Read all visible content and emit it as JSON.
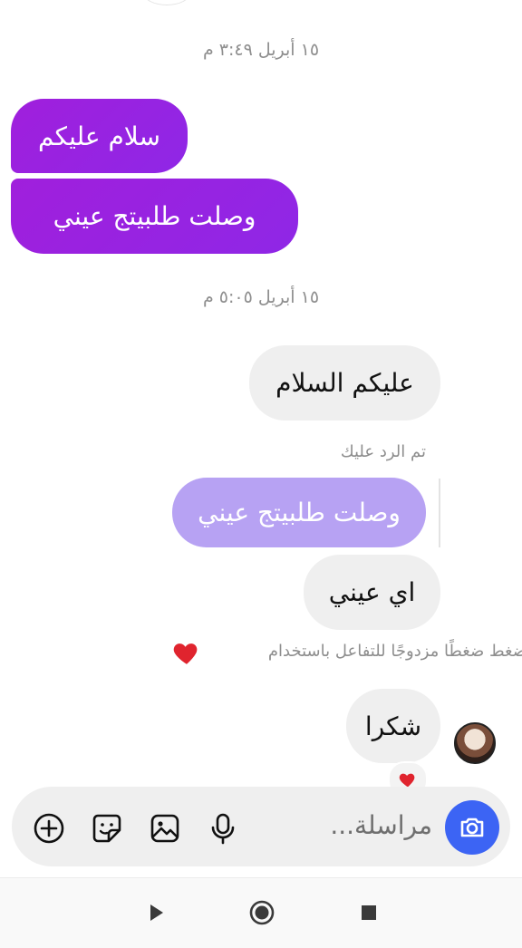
{
  "thread": {
    "timestamp_1": "١٥ أبريل ٣:٤٩ م",
    "timestamp_2": "١٥ أبريل ٥:٠٥ م",
    "messages": [
      {
        "text": "سلام عليكم"
      },
      {
        "text": "وصلت طلبيتج عيني"
      },
      {
        "text": "عليكم السلام"
      },
      {
        "text": "اي عيني"
      },
      {
        "text": "شكرا"
      }
    ],
    "reply_label": "تم الرد عليك",
    "quoted_text": "وصلت طلبيتج عيني",
    "double_tap_hint": "اضغط ضغطًا مزدوجًا للتفاعل باستخدام"
  },
  "composer": {
    "placeholder": "مراسلة..."
  },
  "colors": {
    "accent_purple": "#9b22d8",
    "camera_blue": "#3c64f4",
    "heart_red": "#e0242e"
  },
  "icons": [
    "camera-icon",
    "microphone-icon",
    "gallery-icon",
    "sticker-icon",
    "plus-icon",
    "heart-icon",
    "back-triangle-icon",
    "home-circle-icon",
    "recents-square-icon"
  ]
}
